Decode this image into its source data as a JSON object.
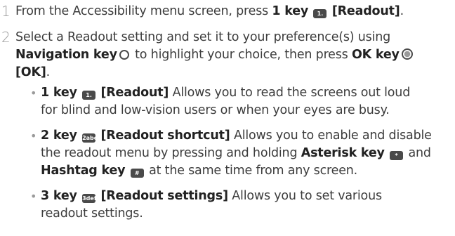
{
  "steps": [
    {
      "number": "1",
      "parts": {
        "a": "From the Accessibility menu screen, press ",
        "b": "1 key",
        "c": "[Readout]",
        "d": "."
      }
    },
    {
      "number": "2",
      "parts": {
        "a": "Select a Readout setting and set it to your preference(s) using",
        "b": "Navigation key",
        "c": " to highlight your choice, then press ",
        "d": "OK key",
        "e": "[OK]",
        "f": "."
      }
    }
  ],
  "bullets": [
    {
      "key": "1 key",
      "label": "[Readout]",
      "text1": " Allows you to read the screens out loud",
      "text2": "for blind and low-vision users or when your eyes are busy."
    },
    {
      "key": "2 key",
      "label": "[Readout shortcut]",
      "text1": " Allows you to enable and disable",
      "text2a": "the readout menu by pressing and holding ",
      "text2b": "Asterisk key",
      "text2c": " and",
      "text3a": "Hashtag key",
      "text3b": " at the same time from any screen."
    },
    {
      "key": "3 key",
      "label": "[Readout settings]",
      "text1": " Allows you to set various",
      "text2": "readout settings."
    }
  ],
  "icons": {
    "key1": "1.",
    "key2": "2abc",
    "key3": "3def",
    "asterisk": "*",
    "hashtag": "#"
  },
  "colors": {
    "text": "#3c3c3c",
    "bold": "#222222",
    "step_number": "#9a9a9a",
    "key_icon": "#4a4a4a"
  }
}
